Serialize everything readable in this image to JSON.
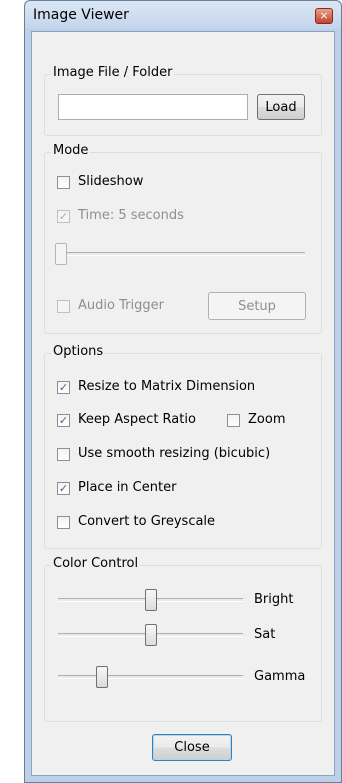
{
  "window": {
    "title": "Image Viewer",
    "close_glyph": "×"
  },
  "file_group": {
    "label": "Image File / Folder",
    "path_value": "",
    "load_label": "Load"
  },
  "mode_group": {
    "label": "Mode",
    "slideshow": {
      "label": "Slideshow",
      "checked": false
    },
    "time": {
      "label": "Time: 5 seconds",
      "checked": true,
      "enabled": false
    },
    "time_slider_fraction": 0.0,
    "audio_trigger": {
      "label": "Audio Trigger",
      "checked": false,
      "enabled": false
    },
    "setup_label": "Setup"
  },
  "options_group": {
    "label": "Options",
    "resize": {
      "label": "Resize to Matrix Dimension",
      "checked": true
    },
    "keep_aspect": {
      "label": "Keep Aspect Ratio",
      "checked": true
    },
    "zoom": {
      "label": "Zoom",
      "checked": false
    },
    "smooth": {
      "label": "Use smooth resizing (bicubic)",
      "checked": false
    },
    "center": {
      "label": "Place in Center",
      "checked": true
    },
    "greyscale": {
      "label": "Convert to Greyscale",
      "checked": false
    }
  },
  "color_group": {
    "label": "Color Control",
    "bright": {
      "label": "Bright",
      "fraction": 0.5
    },
    "sat": {
      "label": "Sat",
      "fraction": 0.5
    },
    "gamma": {
      "label": "Gamma",
      "fraction": 0.22
    }
  },
  "close_label": "Close",
  "check_glyph": "✓",
  "icons": {
    "window_close": "close-icon",
    "checkbox_mark": "checkmark-icon"
  }
}
